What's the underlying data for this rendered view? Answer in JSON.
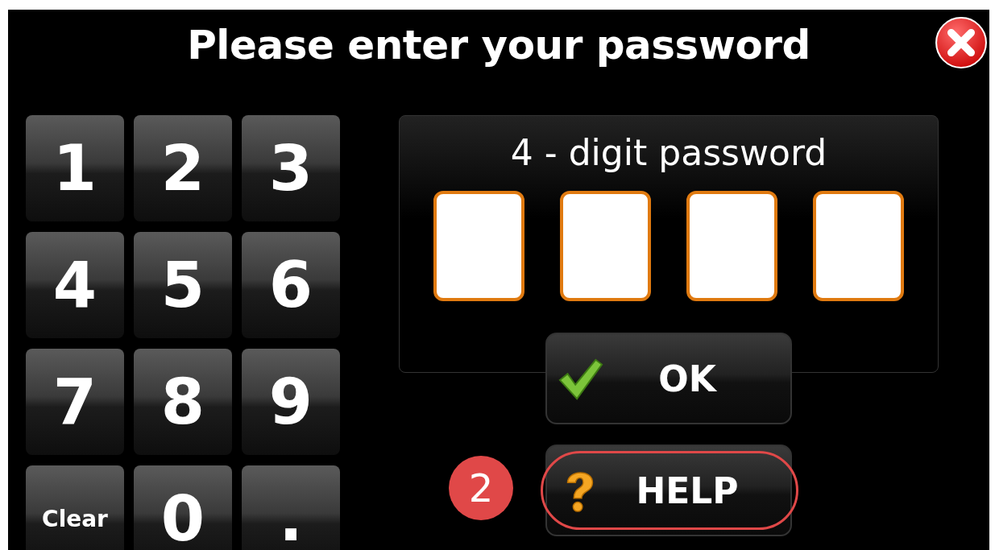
{
  "title": "Please enter your password",
  "keys": [
    {
      "label": "1",
      "kind": "digit"
    },
    {
      "label": "2",
      "kind": "digit"
    },
    {
      "label": "3",
      "kind": "digit"
    },
    {
      "label": "4",
      "kind": "digit"
    },
    {
      "label": "5",
      "kind": "digit"
    },
    {
      "label": "6",
      "kind": "digit"
    },
    {
      "label": "7",
      "kind": "digit"
    },
    {
      "label": "8",
      "kind": "digit"
    },
    {
      "label": "9",
      "kind": "digit"
    },
    {
      "label": "Clear",
      "kind": "clear"
    },
    {
      "label": "0",
      "kind": "digit"
    },
    {
      "label": ".",
      "kind": "digit"
    }
  ],
  "password_panel": {
    "label": "4 - digit password",
    "slots": [
      {
        "filled": false
      },
      {
        "filled": false
      },
      {
        "filled": false
      },
      {
        "filled": false
      }
    ]
  },
  "buttons": [
    {
      "label": "OK",
      "kind": "ok",
      "highlighted": false
    },
    {
      "label": "HELP",
      "kind": "help",
      "highlighted": true
    }
  ],
  "callout": {
    "number": "2"
  }
}
